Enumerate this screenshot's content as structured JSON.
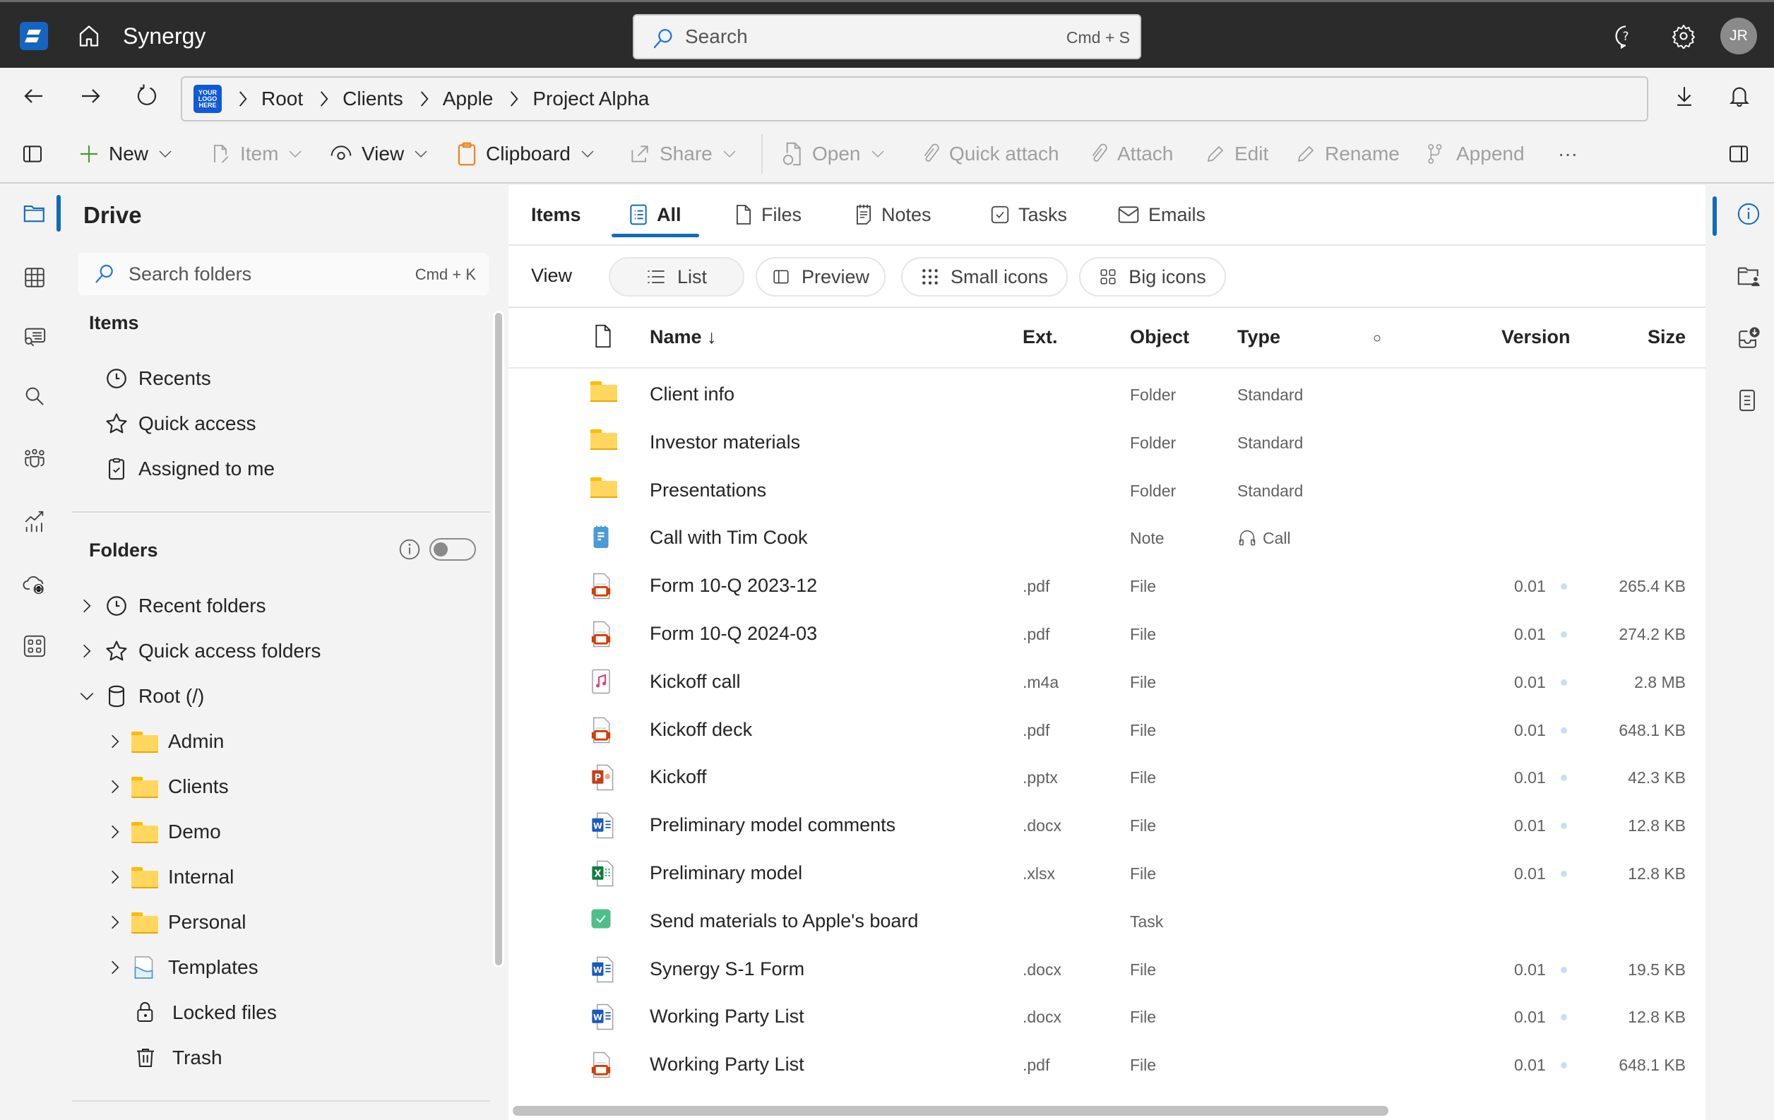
{
  "app": {
    "title": "Synergy",
    "avatar_initials": "JR"
  },
  "search": {
    "placeholder": "Search",
    "shortcut": "Cmd + S"
  },
  "breadcrumb": {
    "logo_text": "YOUR LOGO HERE",
    "items": [
      "Root",
      "Clients",
      "Apple",
      "Project Alpha"
    ]
  },
  "toolbar": {
    "new": "New",
    "item": "Item",
    "view": "View",
    "clipboard": "Clipboard",
    "share": "Share",
    "open": "Open",
    "quick_attach": "Quick attach",
    "attach": "Attach",
    "edit": "Edit",
    "rename": "Rename",
    "append": "Append",
    "more": "···"
  },
  "sidebar": {
    "title": "Drive",
    "search_placeholder": "Search folders",
    "search_shortcut": "Cmd + K",
    "items_title": "Items",
    "items": [
      "Recents",
      "Quick access",
      "Assigned to me"
    ],
    "folders_title": "Folders",
    "folders_toggle_on": false,
    "tree": {
      "recent_folders": "Recent folders",
      "quick_access_folders": "Quick access folders",
      "root": "Root (/)",
      "children": [
        "Admin",
        "Clients",
        "Demo",
        "Internal",
        "Personal",
        "Templates"
      ],
      "locked": "Locked files",
      "trash": "Trash"
    }
  },
  "tabs": {
    "label": "Items",
    "items": [
      "All",
      "Files",
      "Notes",
      "Tasks",
      "Emails"
    ],
    "active": "All"
  },
  "viewbar": {
    "label": "View",
    "options": [
      "List",
      "Preview",
      "Small icons",
      "Big icons"
    ],
    "active": "List"
  },
  "table": {
    "columns": {
      "name": "Name ↓",
      "ext": "Ext.",
      "object": "Object",
      "type": "Type",
      "status": "○",
      "version": "Version",
      "size": "Size"
    },
    "rows": [
      {
        "icon": "folder",
        "name": "Client info",
        "ext": "",
        "object": "Folder",
        "type": "Standard",
        "version": "",
        "size": ""
      },
      {
        "icon": "folder",
        "name": "Investor materials",
        "ext": "",
        "object": "Folder",
        "type": "Standard",
        "version": "",
        "size": ""
      },
      {
        "icon": "folder",
        "name": "Presentations",
        "ext": "",
        "object": "Folder",
        "type": "Standard",
        "version": "",
        "size": ""
      },
      {
        "icon": "note",
        "name": "Call with Tim Cook",
        "ext": "",
        "object": "Note",
        "type": "Call",
        "type_icon": "headset",
        "version": "",
        "size": ""
      },
      {
        "icon": "pdf",
        "name": "Form 10-Q 2023-12",
        "ext": ".pdf",
        "object": "File",
        "type": "",
        "version": "0.01",
        "size": "265.4 KB"
      },
      {
        "icon": "pdf",
        "name": "Form 10-Q 2024-03",
        "ext": ".pdf",
        "object": "File",
        "type": "",
        "version": "0.01",
        "size": "274.2 KB"
      },
      {
        "icon": "audio",
        "name": "Kickoff call",
        "ext": ".m4a",
        "object": "File",
        "type": "",
        "version": "0.01",
        "size": "2.8 MB"
      },
      {
        "icon": "pdf",
        "name": "Kickoff deck",
        "ext": ".pdf",
        "object": "File",
        "type": "",
        "version": "0.01",
        "size": "648.1 KB"
      },
      {
        "icon": "pptx",
        "name": "Kickoff",
        "ext": ".pptx",
        "object": "File",
        "type": "",
        "version": "0.01",
        "size": "42.3 KB"
      },
      {
        "icon": "docx",
        "name": "Preliminary model comments",
        "ext": ".docx",
        "object": "File",
        "type": "",
        "version": "0.01",
        "size": "12.8 KB"
      },
      {
        "icon": "xlsx",
        "name": "Preliminary model",
        "ext": ".xlsx",
        "object": "File",
        "type": "",
        "version": "0.01",
        "size": "12.8 KB"
      },
      {
        "icon": "task",
        "name": "Send materials to Apple's board",
        "ext": "",
        "object": "Task",
        "type": "",
        "version": "",
        "size": ""
      },
      {
        "icon": "docx",
        "name": "Synergy S-1 Form",
        "ext": ".docx",
        "object": "File",
        "type": "",
        "version": "0.01",
        "size": "19.5 KB"
      },
      {
        "icon": "docx",
        "name": "Working Party List",
        "ext": ".docx",
        "object": "File",
        "type": "",
        "version": "0.01",
        "size": "12.8 KB"
      },
      {
        "icon": "pdf",
        "name": "Working Party List",
        "ext": ".pdf",
        "object": "File",
        "type": "",
        "version": "0.01",
        "size": "648.1 KB"
      }
    ]
  },
  "colors": {
    "accent": "#0f6cbd",
    "topbar": "#2b2b2b",
    "folder": "#ffd75e",
    "pdf": "#d83b01",
    "word": "#185abd",
    "excel": "#107c41",
    "powerpoint": "#c43e1c",
    "task": "#4fbf8a",
    "note": "#4a9ad9"
  }
}
